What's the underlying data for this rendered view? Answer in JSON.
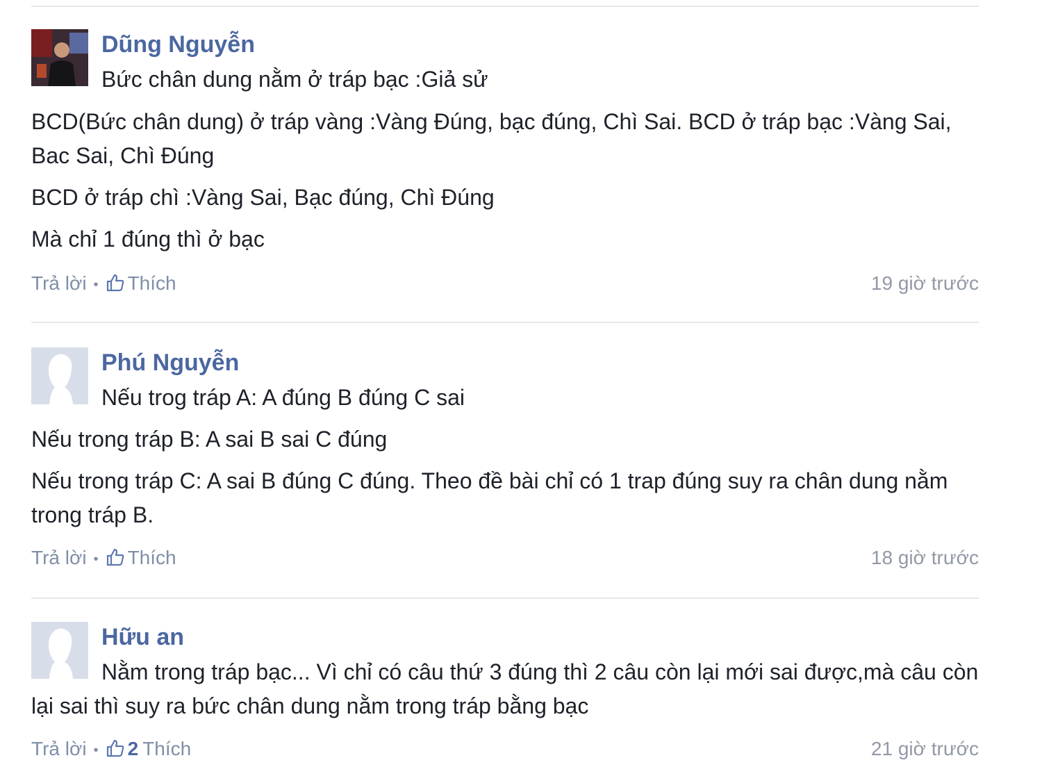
{
  "comments": [
    {
      "author": "Dũng Nguyễn",
      "avatar": "user-photo",
      "first_line": "Bức chân dung nằm ở tráp bạc :Giả sử",
      "paragraphs": [
        "BCD(Bức chân dung) ở tráp vàng :Vàng Đúng, bạc đúng, Chì Sai. BCD ở tráp bạc :Vàng Sai, Bac Sai, Chì Đúng",
        "BCD ở tráp chì :Vàng Sai, Bạc đúng, Chì Đúng",
        "Mà chỉ 1 đúng thì ở bạc"
      ],
      "reply_label": "Trả lời",
      "like_label": "Thích",
      "like_icon": "thumbs-up-icon",
      "time": "19 giờ trước"
    },
    {
      "author": "Phú Nguyễn",
      "avatar": "default-avatar",
      "first_line": "Nếu trog tráp A: A đúng B đúng C sai",
      "paragraphs": [
        "Nếu trong tráp B: A sai B sai C đúng",
        "Nếu trong tráp C: A sai B đúng C đúng. Theo đề bài chỉ có 1 trap đúng suy ra chân dung nằm trong tráp B."
      ],
      "reply_label": "Trả lời",
      "like_label": "Thích",
      "like_icon": "thumbs-up-icon",
      "time": "18 giờ trước"
    },
    {
      "author": "Hữu an",
      "avatar": "default-avatar",
      "first_line": "Nằm trong tráp bạc... Vì chỉ có câu thứ 3 đúng thì 2 câu còn lại mới sai được,mà câu còn lại sai thì suy ra bức chân dung nằm trong tráp bằng bạc",
      "reply_label": "Trả lời",
      "like_count": "2",
      "like_label": "Thích",
      "like_icon": "thumbs-up-icon",
      "time": "21 giờ trước"
    }
  ],
  "colors": {
    "author": "#4b67a1",
    "action": "#7f8fa7",
    "time": "#9199a5",
    "divider": "#e6e7ea"
  }
}
